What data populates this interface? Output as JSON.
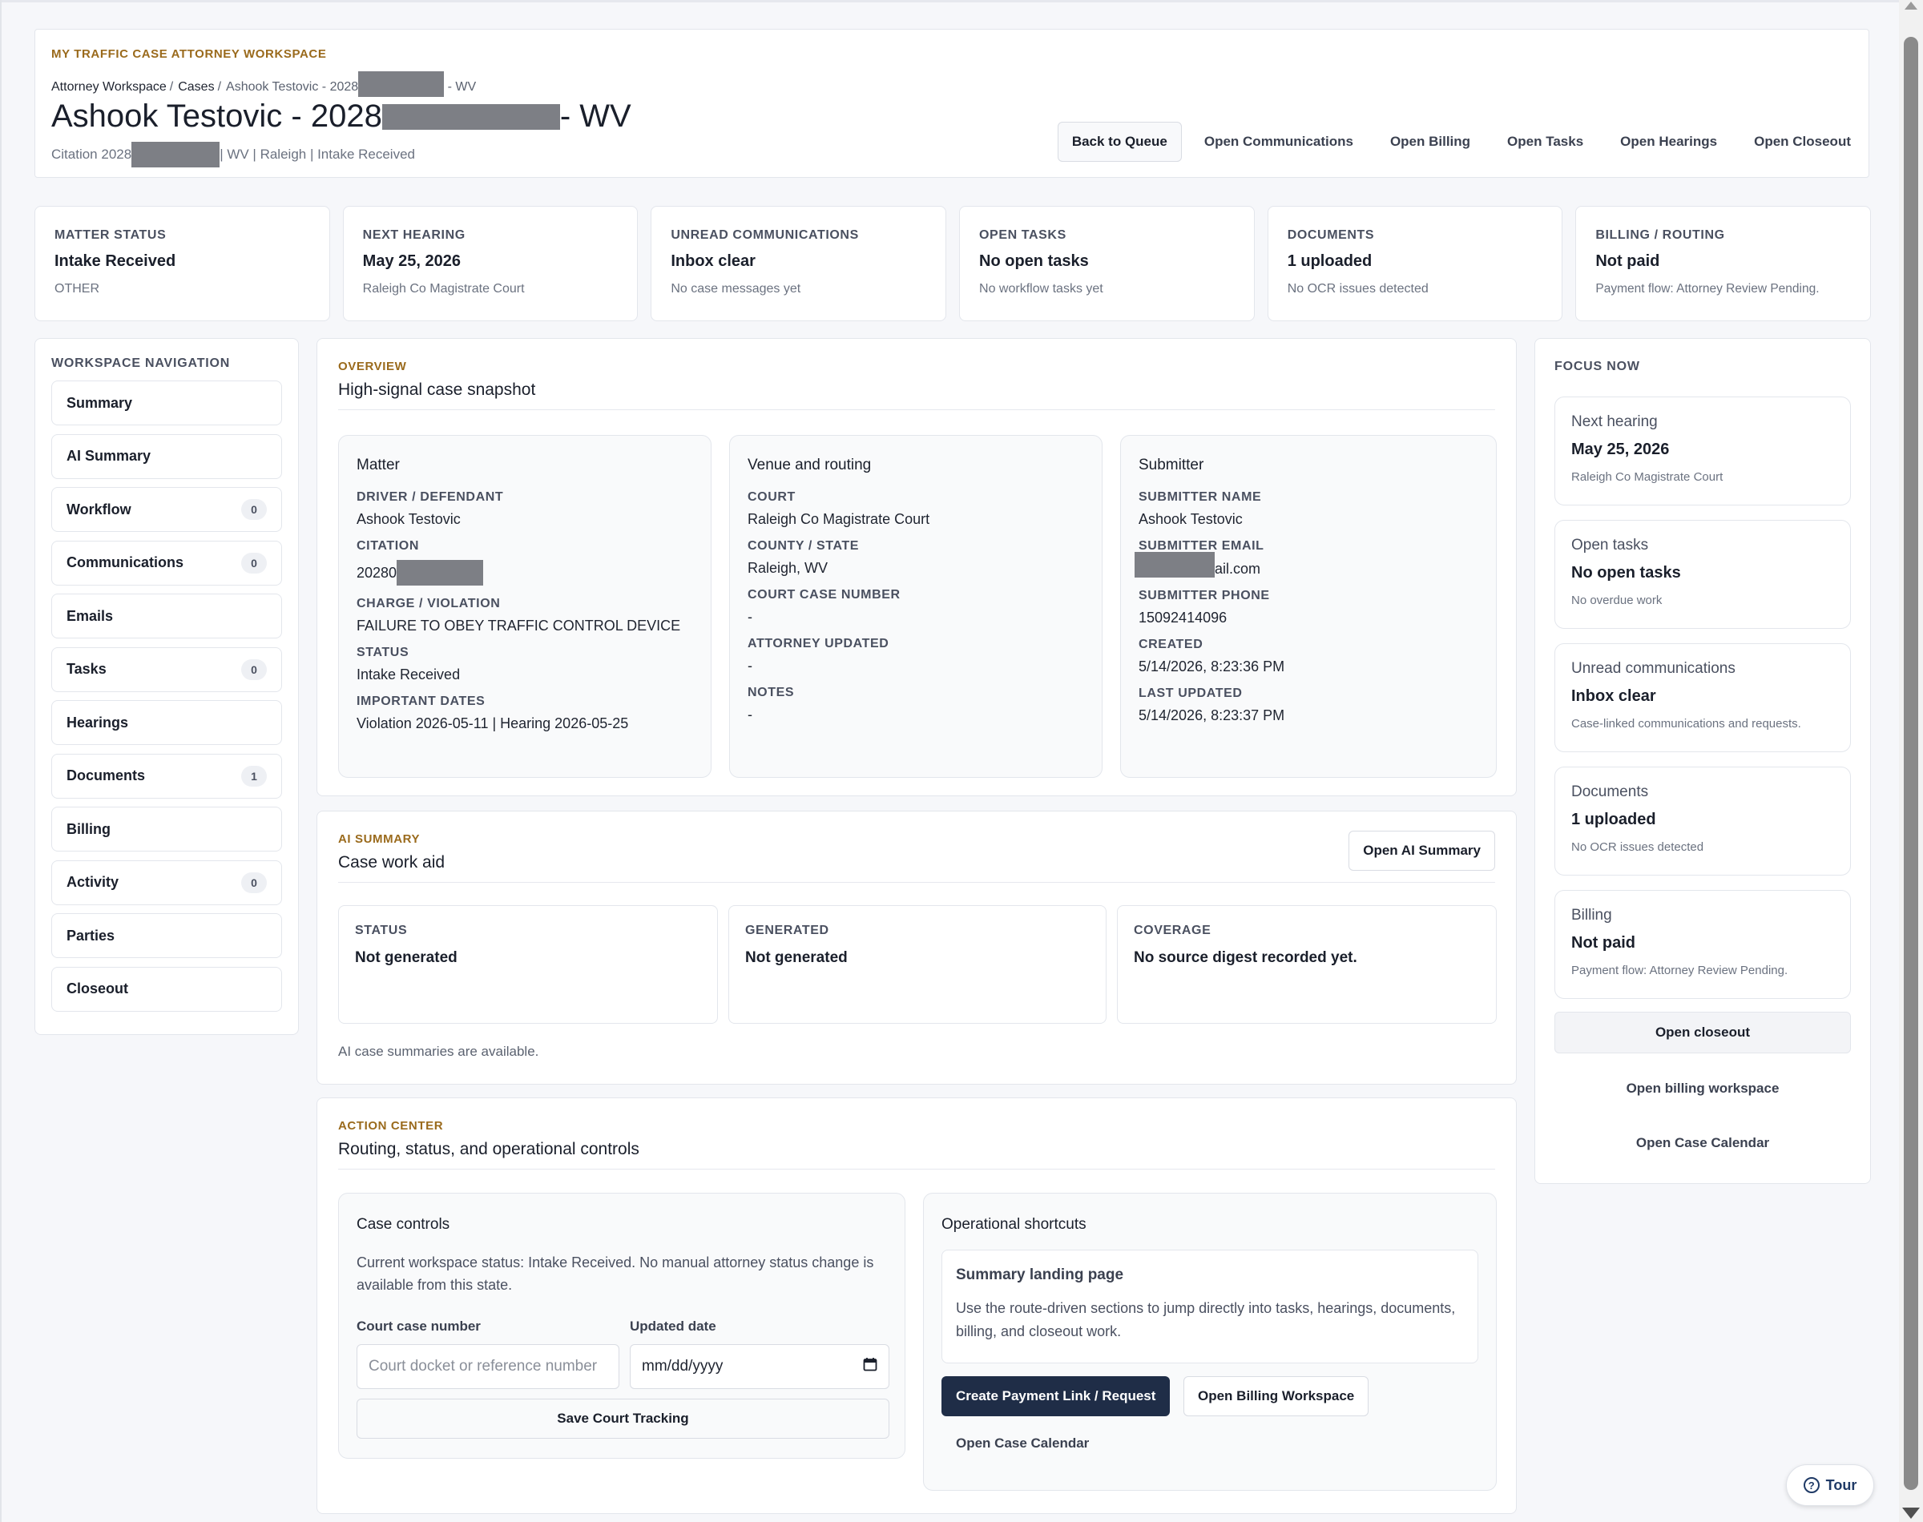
{
  "header": {
    "eyebrow": "MY TRAFFIC CASE ATTORNEY WORKSPACE",
    "breadcrumb": [
      "Attorney Workspace",
      "Cases"
    ],
    "breadcrumb_current_prefix": "Ashook Testovic - 2028",
    "breadcrumb_current_suffix": " - WV",
    "title_prefix": "Ashook Testovic - 2028",
    "title_suffix": " - WV",
    "subtitle_prefix": "Citation 2028",
    "subtitle_suffix": "| WV | Raleigh | Intake Received",
    "actions": {
      "back": "Back to Queue",
      "communications": "Open Communications",
      "billing": "Open Billing",
      "tasks": "Open Tasks",
      "hearings": "Open Hearings",
      "closeout": "Open Closeout"
    }
  },
  "stats": [
    {
      "label": "MATTER STATUS",
      "value": "Intake Received",
      "sub": "OTHER"
    },
    {
      "label": "NEXT HEARING",
      "value": "May 25, 2026",
      "sub": "Raleigh Co Magistrate Court"
    },
    {
      "label": "UNREAD COMMUNICATIONS",
      "value": "Inbox clear",
      "sub": "No case messages yet"
    },
    {
      "label": "OPEN TASKS",
      "value": "No open tasks",
      "sub": "No workflow tasks yet"
    },
    {
      "label": "DOCUMENTS",
      "value": "1 uploaded",
      "sub": "No OCR issues detected"
    },
    {
      "label": "BILLING / ROUTING",
      "value": "Not paid",
      "sub": "Payment flow: Attorney Review Pending."
    }
  ],
  "nav": {
    "title": "WORKSPACE NAVIGATION",
    "items": [
      {
        "label": "Summary",
        "badge": null
      },
      {
        "label": "AI Summary",
        "badge": null
      },
      {
        "label": "Workflow",
        "badge": "0"
      },
      {
        "label": "Communications",
        "badge": "0"
      },
      {
        "label": "Emails",
        "badge": null
      },
      {
        "label": "Tasks",
        "badge": "0"
      },
      {
        "label": "Hearings",
        "badge": null
      },
      {
        "label": "Documents",
        "badge": "1"
      },
      {
        "label": "Billing",
        "badge": null
      },
      {
        "label": "Activity",
        "badge": "0"
      },
      {
        "label": "Parties",
        "badge": null
      },
      {
        "label": "Closeout",
        "badge": null
      }
    ]
  },
  "overview": {
    "eyebrow": "OVERVIEW",
    "title": "High-signal case snapshot",
    "matter": {
      "title": "Matter",
      "driver_label": "DRIVER / DEFENDANT",
      "driver": "Ashook Testovic",
      "citation_label": "CITATION",
      "citation_prefix": "20280",
      "charge_label": "CHARGE / VIOLATION",
      "charge": "FAILURE TO OBEY TRAFFIC CONTROL DEVICE",
      "status_label": "STATUS",
      "status": "Intake Received",
      "dates_label": "IMPORTANT DATES",
      "dates": "Violation 2026-05-11 | Hearing 2026-05-25"
    },
    "venue": {
      "title": "Venue and routing",
      "court_label": "COURT",
      "court": "Raleigh Co Magistrate Court",
      "county_label": "COUNTY / STATE",
      "county": "Raleigh, WV",
      "case_no_label": "COURT CASE NUMBER",
      "case_no": "-",
      "attorney_updated_label": "ATTORNEY UPDATED",
      "attorney_updated": "-",
      "notes_label": "NOTES",
      "notes": "-"
    },
    "submitter": {
      "title": "Submitter",
      "name_label": "SUBMITTER NAME",
      "name": "Ashook Testovic",
      "email_label": "SUBMITTER EMAIL",
      "email_suffix": "ail.com",
      "phone_label": "SUBMITTER PHONE",
      "phone": "15092414096",
      "created_label": "CREATED",
      "created": "5/14/2026, 8:23:36 PM",
      "updated_label": "LAST UPDATED",
      "updated": "5/14/2026, 8:23:37 PM"
    }
  },
  "ai_summary": {
    "eyebrow": "AI SUMMARY",
    "title": "Case work aid",
    "open_button": "Open AI Summary",
    "status_label": "STATUS",
    "status": "Not generated",
    "generated_label": "GENERATED",
    "generated": "Not generated",
    "coverage_label": "COVERAGE",
    "coverage": "No source digest recorded yet.",
    "note": "AI case summaries are available."
  },
  "action_center": {
    "eyebrow": "ACTION CENTER",
    "title": "Routing, status, and operational controls",
    "case_controls": {
      "title": "Case controls",
      "description": "Current workspace status: Intake Received. No manual attorney status change is available from this state.",
      "court_case_label": "Court case number",
      "court_case_placeholder": "Court docket or reference number",
      "updated_date_label": "Updated date",
      "updated_date_placeholder": "mm/dd/yyyy",
      "save_button": "Save Court Tracking"
    },
    "shortcuts": {
      "title": "Operational shortcuts",
      "landing_title": "Summary landing page",
      "landing_desc": "Use the route-driven sections to jump directly into tasks, hearings, documents, billing, and closeout work.",
      "payment_button": "Create Payment Link / Request",
      "billing_button": "Open Billing Workspace",
      "calendar_link": "Open Case Calendar"
    }
  },
  "focus": {
    "title": "FOCUS NOW",
    "cards": [
      {
        "label": "Next hearing",
        "value": "May 25, 2026",
        "sub": "Raleigh Co Magistrate Court"
      },
      {
        "label": "Open tasks",
        "value": "No open tasks",
        "sub": "No overdue work"
      },
      {
        "label": "Unread communications",
        "value": "Inbox clear",
        "sub": "Case-linked communications and requests."
      },
      {
        "label": "Documents",
        "value": "1 uploaded",
        "sub": "No OCR issues detected"
      },
      {
        "label": "Billing",
        "value": "Not paid",
        "sub": "Payment flow: Attorney Review Pending."
      }
    ],
    "closeout_button": "Open closeout",
    "billing_link": "Open billing workspace",
    "calendar_link": "Open Case Calendar"
  },
  "tour": {
    "label": "Tour",
    "icon": "question-circle-icon"
  }
}
